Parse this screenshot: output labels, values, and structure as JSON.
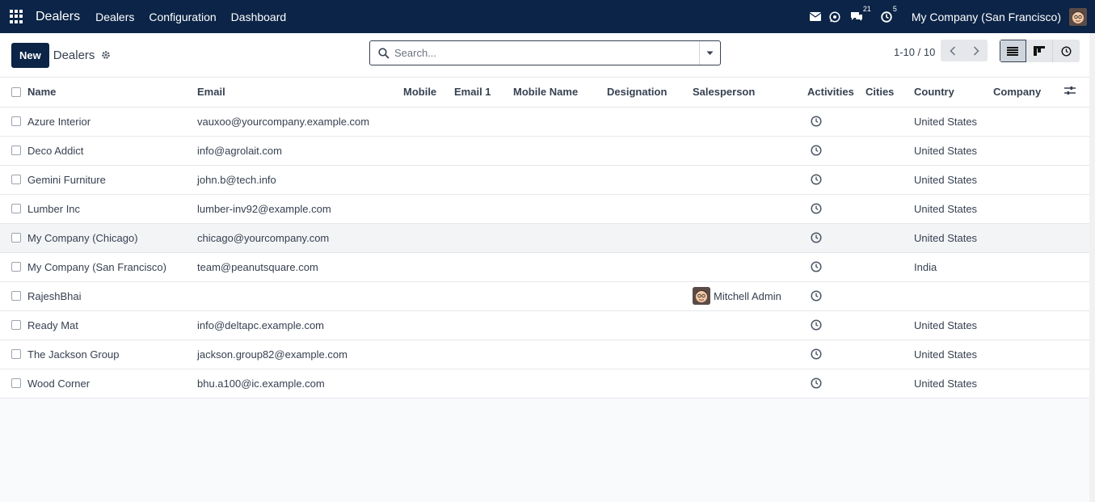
{
  "navbar": {
    "app_name": "Dealers",
    "menus": [
      "Dealers",
      "Configuration",
      "Dashboard"
    ],
    "messages_count": "21",
    "activities_count": "5",
    "company": "My Company (San Francisco)"
  },
  "control": {
    "new_label": "New",
    "title": "Dealers",
    "search_placeholder": "Search...",
    "pager": "1-10 / 10"
  },
  "table": {
    "headers": [
      "Name",
      "Email",
      "Mobile",
      "Email 1",
      "Mobile Name",
      "Designation",
      "Salesperson",
      "Activities",
      "Cities",
      "Country",
      "Company"
    ],
    "rows": [
      {
        "name": "Azure Interior",
        "email": "vauxoo@yourcompany.example.com",
        "salesperson": "",
        "country": "United States"
      },
      {
        "name": "Deco Addict",
        "email": "info@agrolait.com",
        "salesperson": "",
        "country": "United States"
      },
      {
        "name": "Gemini Furniture",
        "email": "john.b@tech.info",
        "salesperson": "",
        "country": "United States"
      },
      {
        "name": "Lumber Inc",
        "email": "lumber-inv92@example.com",
        "salesperson": "",
        "country": "United States"
      },
      {
        "name": "My Company (Chicago)",
        "email": "chicago@yourcompany.com",
        "salesperson": "",
        "country": "United States"
      },
      {
        "name": "My Company (San Francisco)",
        "email": "team@peanutsquare.com",
        "salesperson": "",
        "country": "India"
      },
      {
        "name": "RajeshBhai",
        "email": "",
        "salesperson": "Mitchell Admin",
        "country": ""
      },
      {
        "name": "Ready Mat",
        "email": "info@deltapc.example.com",
        "salesperson": "",
        "country": "United States"
      },
      {
        "name": "The Jackson Group",
        "email": "jackson.group82@example.com",
        "salesperson": "",
        "country": "United States"
      },
      {
        "name": "Wood Corner",
        "email": "bhu.a100@ic.example.com",
        "salesperson": "",
        "country": "United States"
      }
    ]
  },
  "colors": {
    "navbar": "#0b2447",
    "primary": "#0b2447"
  }
}
